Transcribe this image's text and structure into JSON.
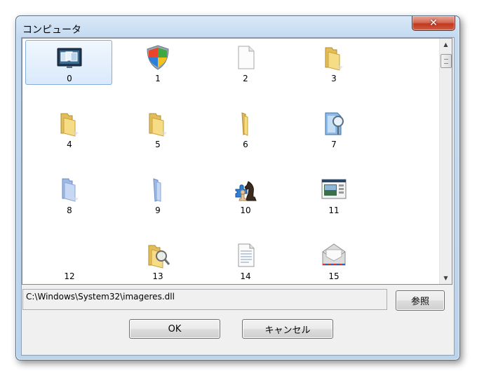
{
  "window": {
    "title": "コンピュータ",
    "close_glyph": "✕"
  },
  "icons": [
    {
      "label": "0",
      "icon": "monitor-slideshow-icon"
    },
    {
      "label": "1",
      "icon": "security-shield-icon"
    },
    {
      "label": "2",
      "icon": "blank-document-icon"
    },
    {
      "label": "3",
      "icon": "folder-icon"
    },
    {
      "label": "4",
      "icon": "folder-icon"
    },
    {
      "label": "5",
      "icon": "folder-icon"
    },
    {
      "label": "6",
      "icon": "folder-side-icon"
    },
    {
      "label": "7",
      "icon": "search-document-icon"
    },
    {
      "label": "8",
      "icon": "blue-folder-icon"
    },
    {
      "label": "9",
      "icon": "blue-folder-side-icon"
    },
    {
      "label": "10",
      "icon": "games-chess-icon"
    },
    {
      "label": "11",
      "icon": "window-picture-icon"
    },
    {
      "label": "12",
      "icon": "empty-icon"
    },
    {
      "label": "13",
      "icon": "folder-search-icon"
    },
    {
      "label": "14",
      "icon": "text-document-icon"
    },
    {
      "label": "15",
      "icon": "mail-envelope-icon"
    }
  ],
  "selected_index": 0,
  "file_path": "C:\\Windows\\System32\\imageres.dll",
  "buttons": {
    "browse": "参照",
    "ok": "OK",
    "cancel": "キャンセル"
  },
  "scrollbar": {
    "up_glyph": "▲",
    "down_glyph": "▼"
  }
}
